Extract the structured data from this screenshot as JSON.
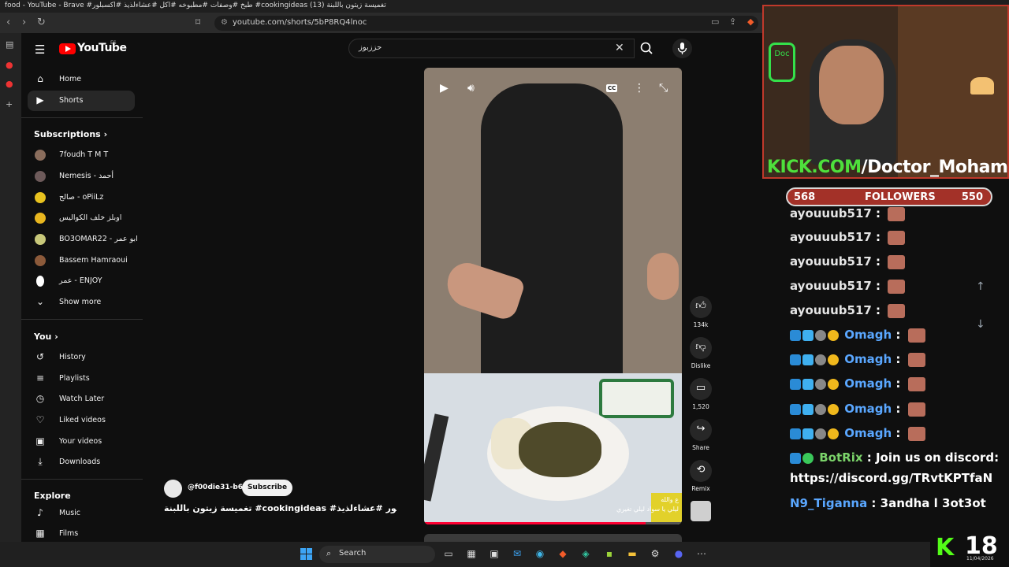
{
  "browser": {
    "window_title": "food - YouTube - Brave #طبخ #وصفات #مطبوخه #اكل #عشاءلذيذ #اكسبلور #cookingideas تغميسة زيتون باللبنة (13)",
    "url": "youtube.com/shorts/5bP8RQ4lnoc"
  },
  "youtube": {
    "logo_text": "YouTube",
    "region": "ES",
    "search_value": "حززبوز"
  },
  "guide": {
    "main": [
      {
        "label": "Home",
        "icon": "home-icon"
      },
      {
        "label": "Shorts",
        "icon": "shorts-icon"
      }
    ],
    "subscriptions_title": "Subscriptions",
    "subscriptions": [
      {
        "label": "7foudh T M T",
        "color": "#8a6d5c"
      },
      {
        "label": "Nemesis - أحمد",
        "color": "#6d5a5a"
      },
      {
        "label": "صالح - oPiiLz",
        "color": "#e8c21f"
      },
      {
        "label": "اوبلز خلف الكواليس",
        "color": "#e8b61f"
      },
      {
        "label": "BO3OMAR22 - ابو عمر",
        "color": "#c8c87a"
      },
      {
        "label": "Bassem Hamraoui",
        "color": "#8c5a3a"
      },
      {
        "label": "عمر - ENJOY",
        "color": "#ffffff"
      }
    ],
    "show_more": "Show more",
    "you_title": "You",
    "you": [
      {
        "label": "History",
        "icon": "history-icon"
      },
      {
        "label": "Playlists",
        "icon": "playlists-icon"
      },
      {
        "label": "Watch Later",
        "icon": "watch-later-icon"
      },
      {
        "label": "Liked videos",
        "icon": "liked-videos-icon"
      },
      {
        "label": "Your videos",
        "icon": "your-videos-icon"
      },
      {
        "label": "Downloads",
        "icon": "downloads-icon"
      }
    ],
    "explore_title": "Explore",
    "explore": [
      {
        "label": "Music",
        "icon": "music-icon"
      },
      {
        "label": "Films",
        "icon": "films-icon"
      }
    ]
  },
  "short": {
    "channel": "@f00die31-b6y",
    "subscribe_label": "Subscribe",
    "title": "تغميسة زيتون باللبنة #cookingideas #اكسبلور #عشاءلذيذ ...",
    "caption_line1": "ع والله",
    "caption_line2": "ليلي يا سواد ليلي تغيري",
    "progress": 0.86,
    "cc": "CC",
    "actions": {
      "likes": "134k",
      "dislike": "Dislike",
      "comments": "1,520",
      "share": "Share",
      "remix": "Remix"
    }
  },
  "stream": {
    "channel_label_prefix": "KICK.COM",
    "channel_label_suffix": "/Doctor_Mohamed",
    "neon_text": "Doc",
    "followers_left": "568",
    "followers_label": "FOLLOWERS",
    "followers_right": "550",
    "chat": [
      {
        "user": "ayouuub517",
        "msg": ""
      },
      {
        "user": "ayouuub517",
        "msg": ""
      },
      {
        "user": "ayouuub517",
        "msg": ""
      },
      {
        "user": "ayouuub517",
        "msg": ""
      },
      {
        "user": "ayouuub517",
        "msg": ""
      },
      {
        "user": "Omagh",
        "msg": ""
      },
      {
        "user": "Omagh",
        "msg": ""
      },
      {
        "user": "Omagh",
        "msg": ""
      },
      {
        "user": "Omagh",
        "msg": ""
      },
      {
        "user": "Omagh",
        "msg": ""
      }
    ],
    "bot_user": "BotRix",
    "bot_msg": "Join us on discord:",
    "bot_link": "https://discord.gg/TRvtKPTfaN",
    "last_user": "N9_Tiganna",
    "last_msg": "3andha l 3ot3ot",
    "kick_count": "18",
    "kick_date": "11/04/2026"
  },
  "taskbar": {
    "search_label": "Search"
  }
}
